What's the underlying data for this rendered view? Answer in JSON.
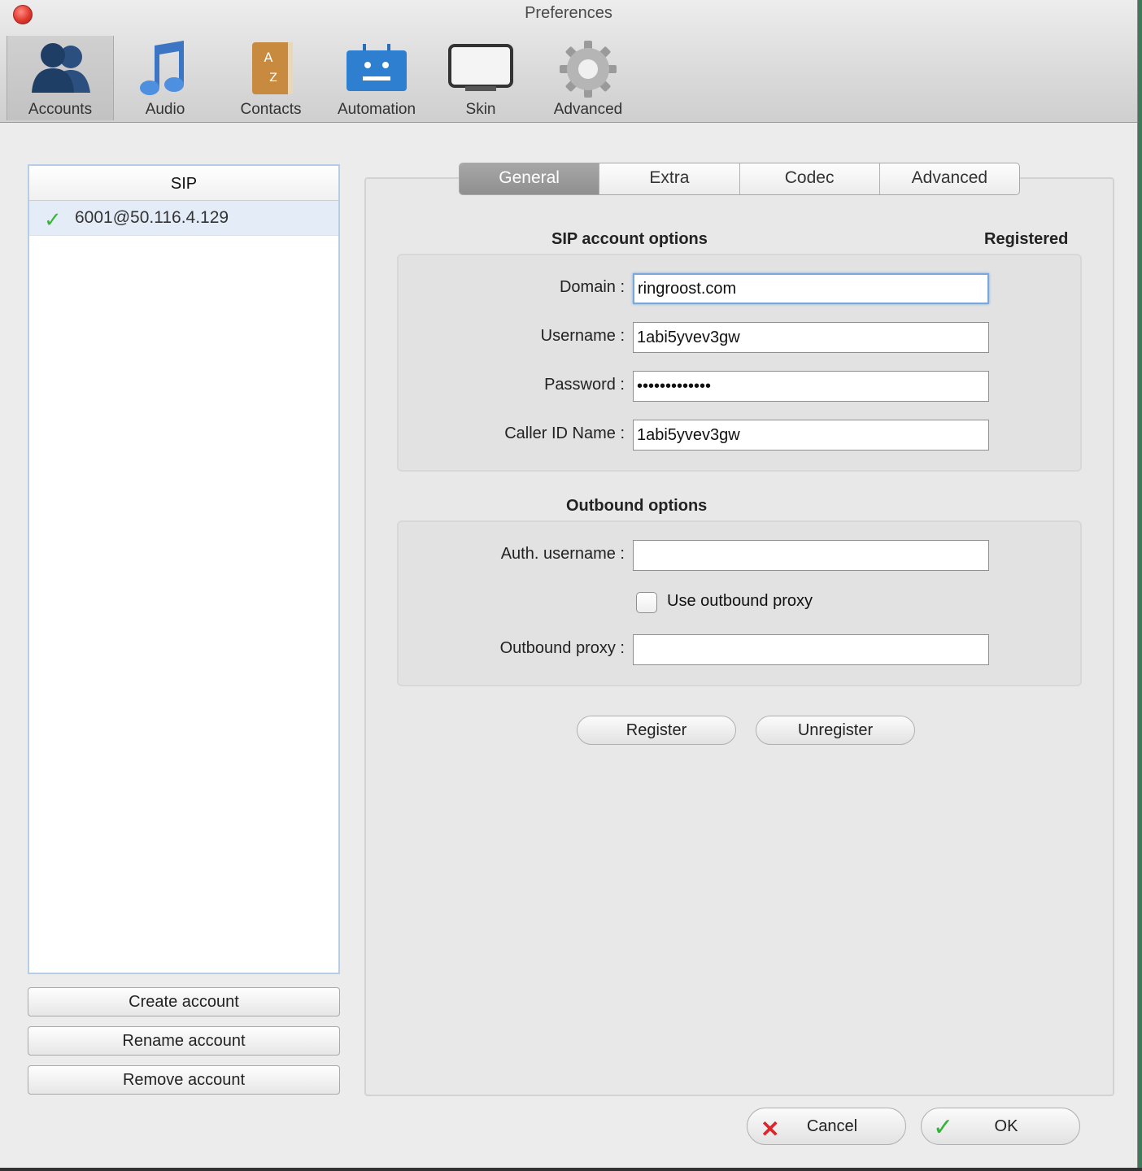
{
  "window": {
    "title": "Preferences"
  },
  "toolbar": [
    {
      "label": "Accounts",
      "icon": "accounts-icon",
      "active": true
    },
    {
      "label": "Audio",
      "icon": "audio-icon"
    },
    {
      "label": "Contacts",
      "icon": "contacts-icon"
    },
    {
      "label": "Automation",
      "icon": "automation-icon"
    },
    {
      "label": "Skin",
      "icon": "skin-icon"
    },
    {
      "label": "Advanced",
      "icon": "gear-icon"
    }
  ],
  "accounts_list": {
    "header": "SIP",
    "items": [
      {
        "name": "6001@50.116.4.129",
        "status": "registered"
      }
    ]
  },
  "account_buttons": {
    "create": "Create account",
    "rename": "Rename account",
    "remove": "Remove account"
  },
  "tabs": [
    "General",
    "Extra",
    "Codec",
    "Advanced"
  ],
  "general": {
    "sip_section": "SIP account options",
    "status": "Registered",
    "domain_label": "Domain :",
    "domain": "ringroost.com",
    "username_label": "Username :",
    "username": "1abi5yvev3gw",
    "password_label": "Password :",
    "password": "•••••••••••••",
    "callerid_label": "Caller ID Name :",
    "callerid": "1abi5yvev3gw",
    "outbound_section": "Outbound options",
    "auth_label": "Auth. username :",
    "auth_username": "",
    "use_proxy_label": "Use outbound proxy",
    "use_proxy_checked": false,
    "proxy_label": "Outbound proxy :",
    "proxy": "",
    "register": "Register",
    "unregister": "Unregister"
  },
  "dialog": {
    "cancel": "Cancel",
    "ok": "OK"
  },
  "colors": {
    "check": "#3cb43c",
    "cancel_x": "#e0242a",
    "focus": "#7aa7dc"
  }
}
